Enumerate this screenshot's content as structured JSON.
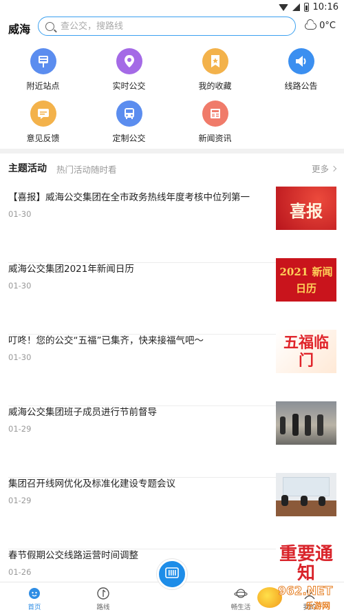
{
  "status_bar": {
    "time": "10:16"
  },
  "header": {
    "city": "威海",
    "search_placeholder": "查公交，搜路线",
    "weather": "0°C"
  },
  "quick_menu": [
    {
      "label": "附近站点",
      "icon": "bus-stop-icon",
      "color": "#5b8def"
    },
    {
      "label": "实时公交",
      "icon": "location-pin-icon",
      "color": "#a46ae6"
    },
    {
      "label": "我的收藏",
      "icon": "bookmark-star-icon",
      "color": "#f3b24b"
    },
    {
      "label": "线路公告",
      "icon": "speaker-icon",
      "color": "#3b8ff0"
    },
    {
      "label": "意见反馈",
      "icon": "feedback-chat-icon",
      "color": "#f3b24b"
    },
    {
      "label": "定制公交",
      "icon": "bus-icon",
      "color": "#5b8def"
    },
    {
      "label": "新闻资讯",
      "icon": "newspaper-icon",
      "color": "#f07b6a"
    }
  ],
  "section": {
    "title": "主题活动",
    "subtitle": "热门活动随时看",
    "more": "更多"
  },
  "news": [
    {
      "title": "【喜报】威海公交集团在全市政务热线年度考核中位列第一",
      "date": "01-30",
      "thumb_text": "喜报"
    },
    {
      "title": "威海公交集团2021年新闻日历",
      "date": "01-30",
      "thumb_text": "2021 新闻日历"
    },
    {
      "title": "叮咚！您的公交“五福”已集齐，快来接福气吧～",
      "date": "01-30",
      "thumb_text": "五福临门"
    },
    {
      "title": "威海公交集团班子成员进行节前督导",
      "date": "01-29",
      "thumb_text": ""
    },
    {
      "title": "集团召开线网优化及标准化建设专题会议",
      "date": "01-29",
      "thumb_text": ""
    },
    {
      "title": "春节假期公交线路运营时间调整",
      "date": "01-26",
      "thumb_text": "重要通知"
    }
  ],
  "bottom_nav": [
    {
      "label": "首页",
      "icon": "home-icon"
    },
    {
      "label": "路线",
      "icon": "route-icon"
    },
    {
      "label": "",
      "icon": "scan-card-icon"
    },
    {
      "label": "畅生活",
      "icon": "planet-icon"
    },
    {
      "label": "我的",
      "icon": "user-icon"
    }
  ],
  "watermark": {
    "text": "962.NET",
    "sub": "乐游网"
  },
  "colors": {
    "accent": "#1e8de8",
    "search_border": "#3aa0f0"
  }
}
